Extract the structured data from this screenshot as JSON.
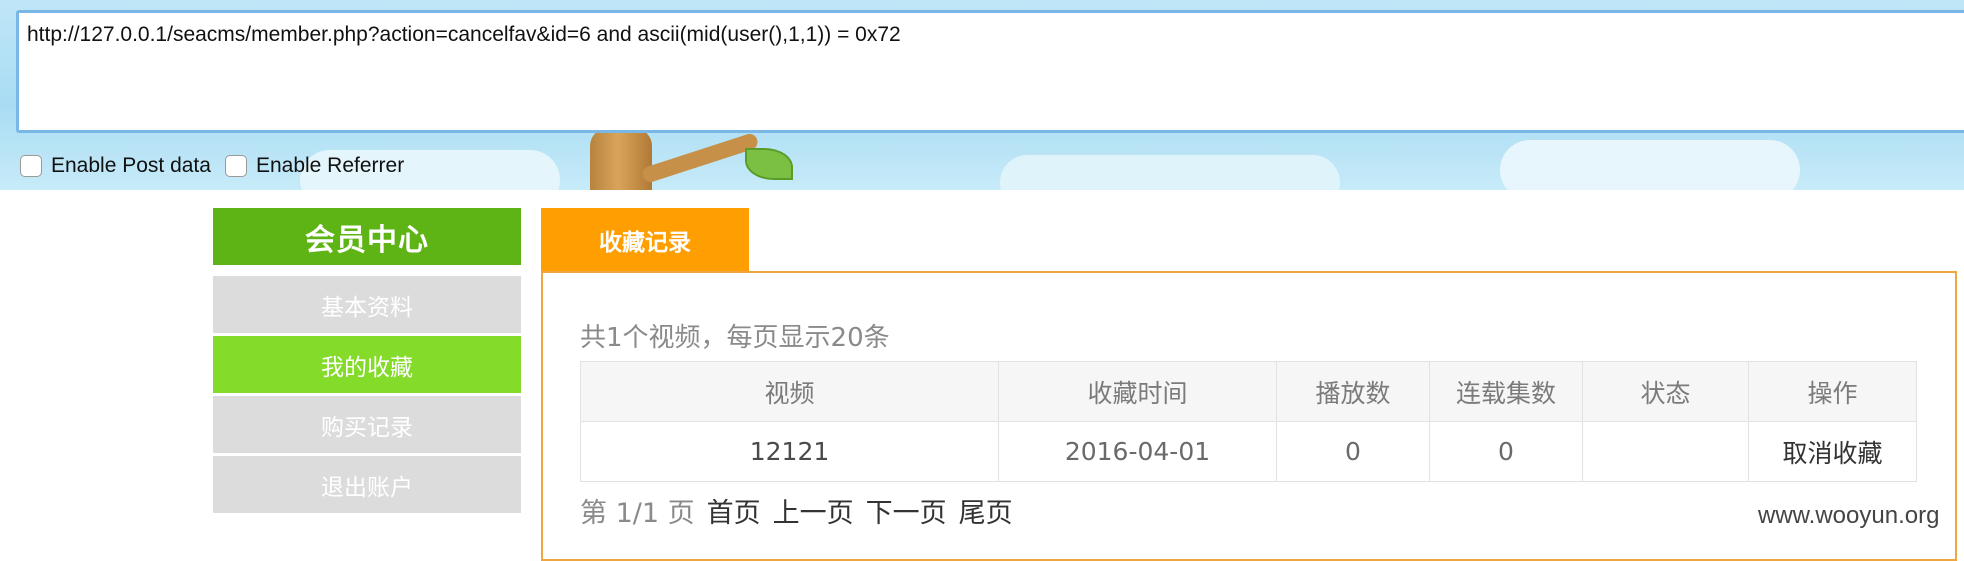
{
  "hackbar": {
    "url": "http://127.0.0.1/seacms/member.php?action=cancelfav&id=6 and ascii(mid(user(),1,1)) = 0x72",
    "post_label": "Enable Post data",
    "referrer_label": "Enable Referrer"
  },
  "sidebar": {
    "title": "会员中心",
    "items": [
      {
        "label": "基本资料"
      },
      {
        "label": "我的收藏"
      },
      {
        "label": "购买记录"
      },
      {
        "label": "退出账户"
      }
    ]
  },
  "tab": {
    "label": "收藏记录"
  },
  "summary": "共1个视频，每页显示20条",
  "table": {
    "headers": [
      "视频",
      "收藏时间",
      "播放数",
      "连载集数",
      "状态",
      "操作"
    ],
    "rows": [
      {
        "video": "12121",
        "time": "2016-04-01",
        "plays": "0",
        "episodes": "0",
        "status": "",
        "action": "取消收藏"
      }
    ]
  },
  "pager": {
    "page_text": "第 1/1 页",
    "first": "首页",
    "prev": "上一页",
    "next": "下一页",
    "last": "尾页"
  },
  "watermark": "www.wooyun.org",
  "colors": {
    "sidebar_title": "#5eb315",
    "sidebar_active": "#84db2a",
    "tab": "#ff9e00",
    "panel_border": "#f0a640"
  }
}
